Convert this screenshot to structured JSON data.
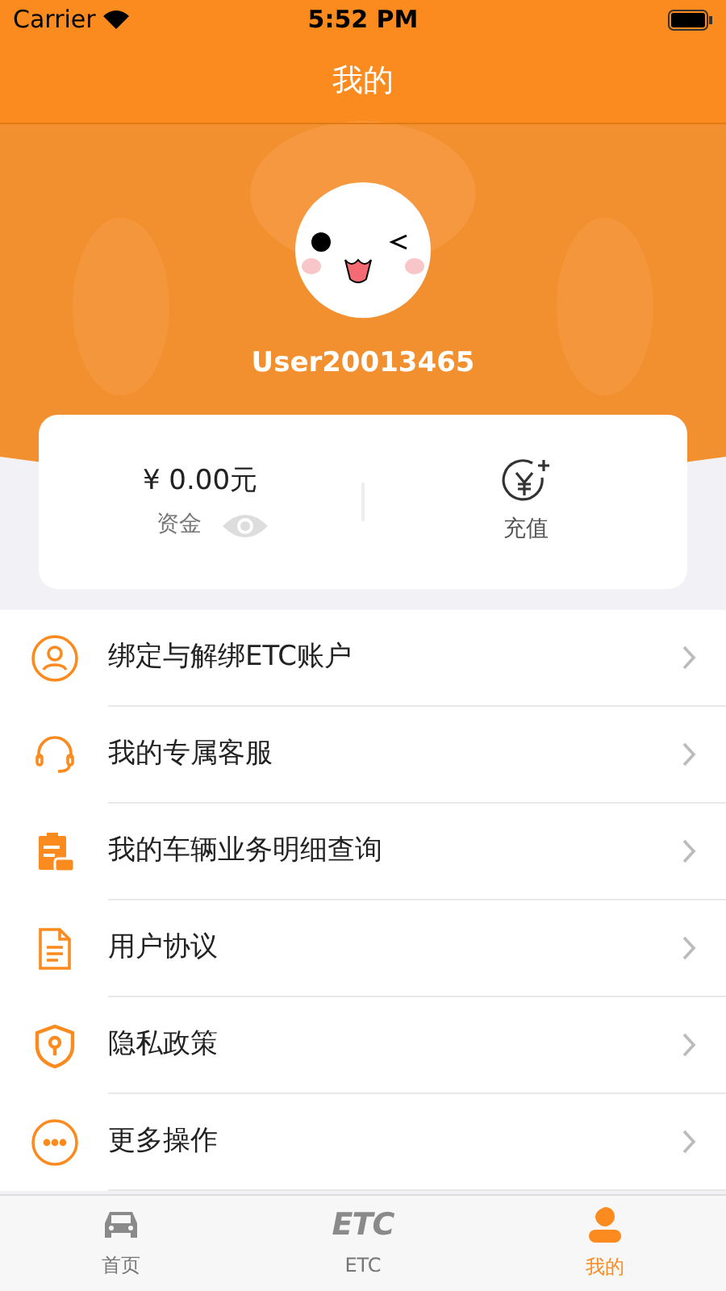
{
  "status_bar": {
    "carrier": "Carrier",
    "time": "5:52 PM"
  },
  "nav": {
    "title": "我的"
  },
  "profile": {
    "username": "User20013465"
  },
  "wallet": {
    "amount": "¥ 0.00元",
    "label": "资金",
    "hidden": false,
    "action": "充值"
  },
  "menu": [
    {
      "kind": "person",
      "label": "绑定与解绑ETC账户"
    },
    {
      "kind": "headset",
      "label": "我的专属客服"
    },
    {
      "kind": "clipboard",
      "label": "我的车辆业务明细查询"
    },
    {
      "kind": "document",
      "label": "用户协议"
    },
    {
      "kind": "shield",
      "label": "隐私政策"
    },
    {
      "kind": "more",
      "label": "更多操作"
    }
  ],
  "tabs": [
    {
      "kind": "car",
      "label": "首页",
      "selected": false
    },
    {
      "kind": "logo",
      "logo": "ETC",
      "label": "ETC",
      "selected": false
    },
    {
      "kind": "person",
      "label": "我的",
      "selected": true
    }
  ]
}
